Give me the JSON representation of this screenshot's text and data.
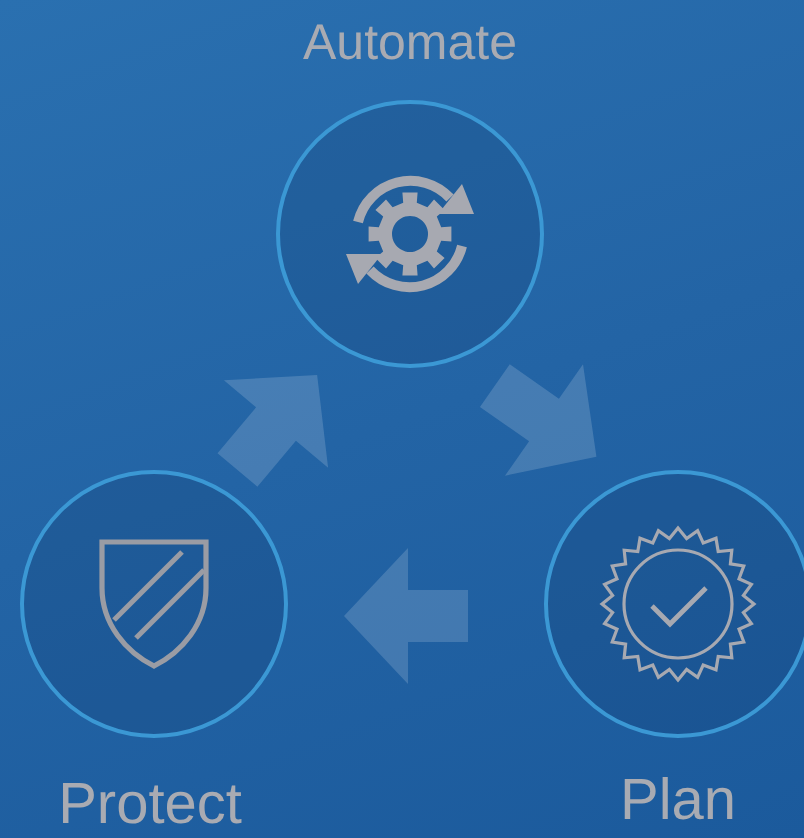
{
  "cycle_nodes": [
    {
      "label": "Automate",
      "kind": "gear"
    },
    {
      "label": "Plan",
      "kind": "seal"
    },
    {
      "label": "Protect",
      "kind": "shield"
    }
  ]
}
